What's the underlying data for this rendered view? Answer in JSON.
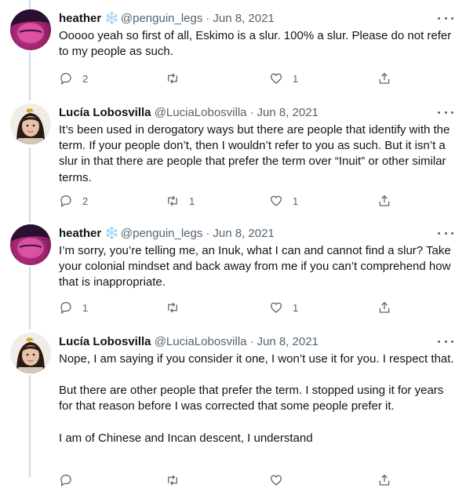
{
  "tweets": [
    {
      "name": "heather",
      "badge": "❄️",
      "handle": "@penguin_legs",
      "separator": "·",
      "date": "Jun 8, 2021",
      "paragraphs": [
        "Ooooo yeah so first of all, Eskimo is a slur. 100% a slur. Please do not refer to my people as such."
      ],
      "replies": "2",
      "retweets": "",
      "likes": "1"
    },
    {
      "name": "Lucía Lobosvilla",
      "handle": "@LuciaLobosvilla",
      "separator": "·",
      "date": "Jun 8, 2021",
      "paragraphs": [
        "It’s been used in derogatory ways but there are people that identify with the term. If your people don’t, then I wouldn’t refer to you as such. But it isn’t a slur in that there are people that prefer the term over “Inuit” or other similar terms."
      ],
      "replies": "2",
      "retweets": "1",
      "likes": "1"
    },
    {
      "name": "heather",
      "badge": "❄️",
      "handle": "@penguin_legs",
      "separator": "·",
      "date": "Jun 8, 2021",
      "paragraphs": [
        "I’m sorry, you’re telling me, an Inuk, what I can and cannot find a slur? Take your colonial mindset and back away from me if you can’t comprehend how that is inappropriate."
      ],
      "replies": "1",
      "retweets": "",
      "likes": "1"
    },
    {
      "name": "Lucía Lobosvilla",
      "handle": "@LuciaLobosvilla",
      "separator": "·",
      "date": "Jun 8, 2021",
      "paragraphs": [
        "Nope, I am saying if you consider it one, I won’t use it for you. I respect that.",
        "But there are other people that prefer the term. I stopped using it for years for that reason before I was corrected that some people prefer it.",
        "I am of Chinese and Incan descent, I understand"
      ],
      "replies": "",
      "retweets": "",
      "likes": ""
    }
  ],
  "icons": {
    "more": "more-icon",
    "reply": "reply-icon",
    "retweet": "retweet-icon",
    "like": "like-icon",
    "share": "share-icon",
    "badge": "snowflake-icon"
  },
  "colors": {
    "text": "#0f1419",
    "secondary": "#536471",
    "badge": "#1d9bf0",
    "thread_line": "#cfd9de"
  }
}
